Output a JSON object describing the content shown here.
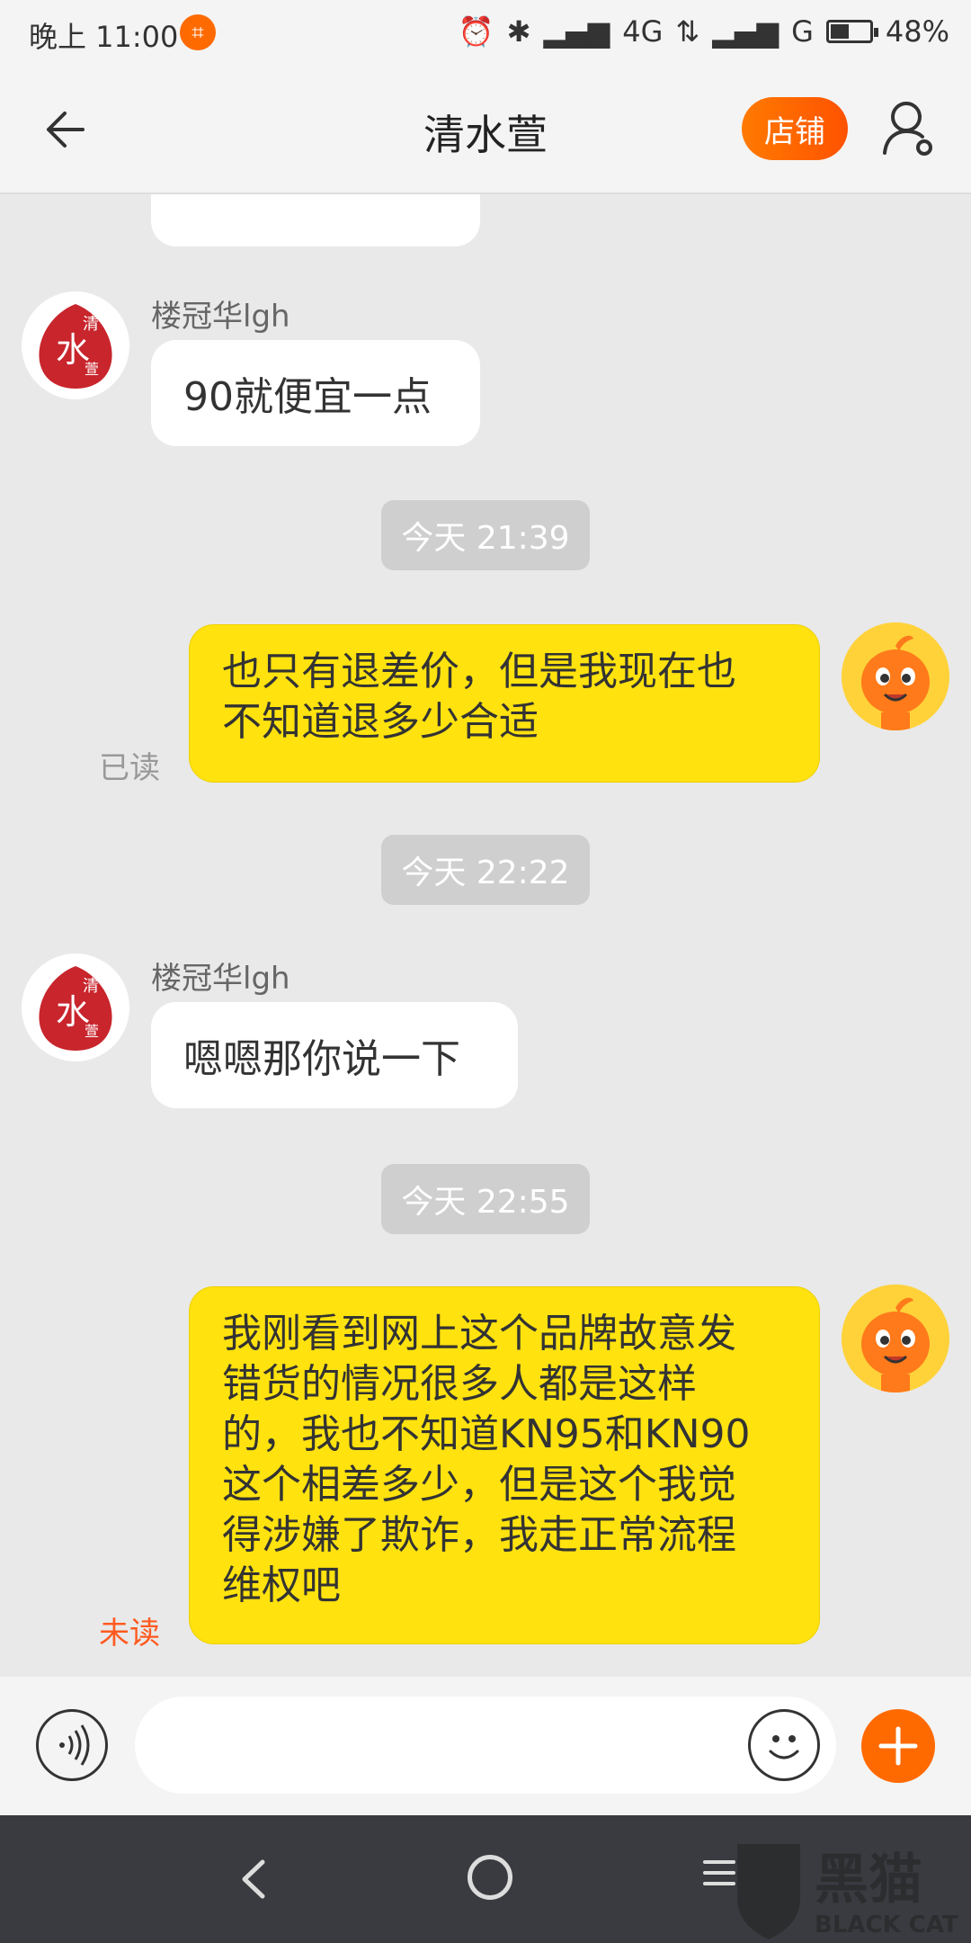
{
  "status_bar": {
    "time": "晚上 11:00",
    "network1": "4G",
    "network2": "G",
    "battery": "48%",
    "battery_level": 0.48
  },
  "header": {
    "title": "清水萱",
    "shop_label": "店铺"
  },
  "messages": {
    "m1": {
      "sender": "楼冠华lgh",
      "text": "90就便宜一点"
    },
    "t1": "今天  21:39",
    "m2": {
      "lines": [
        "也只有退差价，但是我现在也",
        "不知道退多少合适"
      ],
      "status": "已读"
    },
    "t2": "今天  22:22",
    "m3": {
      "sender": "楼冠华lgh",
      "text": "嗯嗯那你说一下"
    },
    "t3": "今天  22:55",
    "m4": {
      "lines": [
        "我刚看到网上这个品牌故意发",
        "错货的情况很多人都是这样",
        "的，我也不知道KN95和KN90",
        "这个相差多少，但是这个我觉",
        "得涉嫌了欺诈，我走正常流程",
        "维权吧"
      ],
      "status": "未读"
    }
  },
  "shop_avatar": {
    "chars": [
      "清",
      "水",
      "萱"
    ]
  },
  "input": {
    "placeholder": ""
  },
  "watermark": {
    "text": "黑猫",
    "subtext": "BLACK CAT"
  },
  "colors": {
    "accent": "#ff6a00",
    "my_bubble": "#ffe20e",
    "unread": "#ff5a1f"
  }
}
